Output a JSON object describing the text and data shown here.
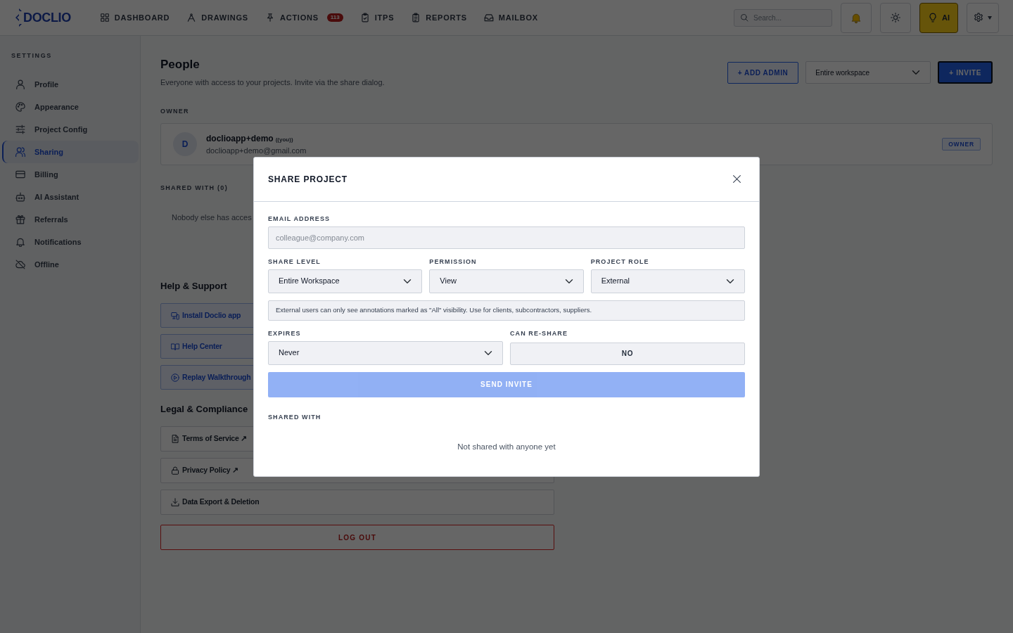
{
  "navbar": {
    "logo": "DOCLIO",
    "items": [
      {
        "label": "DASHBOARD",
        "selected": false
      },
      {
        "label": "DRAWINGS",
        "selected": false
      },
      {
        "label": "ACTIONS",
        "badge": "113",
        "selected": false
      },
      {
        "label": "ITPS",
        "selected": false
      },
      {
        "label": "REPORTS",
        "selected": false
      },
      {
        "label": "MAILBOX",
        "selected": false
      }
    ],
    "search": {
      "placeholder": "Search..."
    },
    "ai_button": "AI"
  },
  "sidebar": {
    "heading": "SETTINGS",
    "items": [
      {
        "label": "Profile",
        "selected": false
      },
      {
        "label": "Appearance",
        "selected": false
      },
      {
        "label": "Project Config",
        "selected": false
      },
      {
        "label": "Sharing",
        "selected": true
      },
      {
        "label": "Billing",
        "selected": false
      },
      {
        "label": "AI Assistant",
        "selected": false
      },
      {
        "label": "Referrals",
        "selected": false
      },
      {
        "label": "Notifications",
        "selected": false
      },
      {
        "label": "Offline",
        "selected": false
      }
    ]
  },
  "page": {
    "title": "People",
    "subtitle": "Everyone with access to your projects. Invite via the share dialog.",
    "add_admin_button": "+ ADD ADMIN",
    "scope_select": "Entire workspace",
    "invite_button": "+ INVITE"
  },
  "owner": {
    "heading": "OWNER",
    "avatar": "D",
    "name": "doclioapp+demo",
    "note": "((you))",
    "email": "doclioapp+demo@gmail.com",
    "badge": "OWNER"
  },
  "shared_with": {
    "heading": "SHARED WITH (0)",
    "empty_text": "Nobody else has acces"
  },
  "help": {
    "heading": "Help & Support",
    "links": [
      "Install Doclio app",
      "Help Center",
      "Replay Walkthrough"
    ]
  },
  "legal": {
    "heading": "Legal & Compliance",
    "links": [
      "Terms of Service ↗",
      "Privacy Policy ↗",
      "Data Export & Deletion"
    ]
  },
  "logout_button": "LOG OUT",
  "modal": {
    "title": "SHARE PROJECT",
    "email": {
      "label": "EMAIL ADDRESS",
      "placeholder": "colleague@company.com"
    },
    "selects": [
      {
        "label": "SHARE LEVEL",
        "value": "Entire Workspace"
      },
      {
        "label": "PERMISSION",
        "value": "View"
      },
      {
        "label": "PROJECT ROLE",
        "value": "External"
      }
    ],
    "note": "External users can only see annotations marked as \"All\" visibility. Use for clients, subcontractors, suppliers.",
    "expires": {
      "label": "EXPIRES",
      "value": "Never"
    },
    "reshare": {
      "label": "CAN RE-SHARE",
      "value": "NO"
    },
    "send_button": {
      "label": "SEND INVITE",
      "disabled": true
    },
    "shared_with": {
      "heading": "SHARED WITH",
      "empty_text": "Not shared with anyone yet"
    }
  }
}
